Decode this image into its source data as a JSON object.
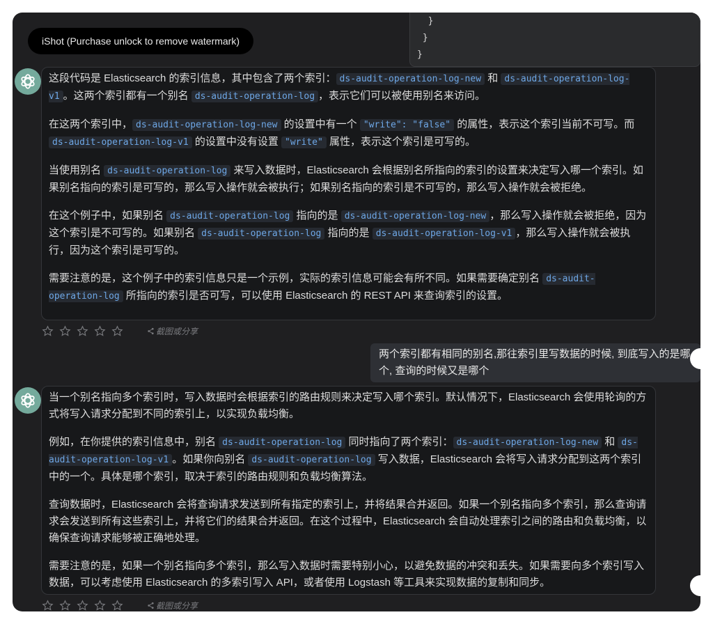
{
  "watermark": "iShot (Purchase unlock to remove watermark)",
  "code_tail": [
    "  }",
    " }",
    "}"
  ],
  "message1": {
    "p1": {
      "t1": "这段代码是 Elasticsearch 的索引信息，其中包含了两个索引：",
      "c1": "ds-audit-operation-log-new",
      "t2": " 和 ",
      "c2": "ds-audit-operation-log-v1",
      "t3": "。这两个索引都有一个别名 ",
      "c3": "ds-audit-operation-log",
      "t4": "，表示它们可以被使用别名来访问。"
    },
    "p2": {
      "t1": "在这两个索引中，",
      "c1": "ds-audit-operation-log-new",
      "t2": " 的设置中有一个 ",
      "c2": "\"write\": \"false\"",
      "t3": " 的属性，表示这个索引当前不可写。而 ",
      "c3": "ds-audit-operation-log-v1",
      "t4": " 的设置中没有设置 ",
      "c4": "\"write\"",
      "t5": " 属性，表示这个索引是可写的。"
    },
    "p3": {
      "t1": "当使用别名 ",
      "c1": "ds-audit-operation-log",
      "t2": " 来写入数据时，Elasticsearch 会根据别名所指向的索引的设置来决定写入哪一个索引。如果别名指向的索引是可写的，那么写入操作就会被执行；如果别名指向的索引是不可写的，那么写入操作就会被拒绝。"
    },
    "p4": {
      "t1": "在这个例子中，如果别名 ",
      "c1": "ds-audit-operation-log",
      "t2": " 指向的是 ",
      "c2": "ds-audit-operation-log-new",
      "t3": "，那么写入操作就会被拒绝，因为这个索引是不可写的。如果别名 ",
      "c3": "ds-audit-operation-log",
      "t4": " 指向的是 ",
      "c4": "ds-audit-operation-log-v1",
      "t5": "，那么写入操作就会被执行，因为这个索引是可写的。"
    },
    "p5": {
      "t1": "需要注意的是，这个例子中的索引信息只是一个示例，实际的索引信息可能会有所不同。如果需要确定别名 ",
      "c1": "ds-audit-operation-log",
      "t2": " 所指向的索引是否可写，可以使用 Elasticsearch 的 REST API 来查询索引的设置。"
    }
  },
  "share_label": "截图或分享",
  "user_message": "两个索引都有相同的别名,那往索引里写数据的时候, 到底写入的是哪个, 查询的时候又是哪个",
  "message2": {
    "p1": {
      "t1": "当一个别名指向多个索引时，写入数据时会根据索引的路由规则来决定写入哪个索引。默认情况下，Elasticsearch 会使用轮询的方式将写入请求分配到不同的索引上，以实现负载均衡。"
    },
    "p2": {
      "t1": "例如，在你提供的索引信息中，别名 ",
      "c1": "ds-audit-operation-log",
      "t2": " 同时指向了两个索引：",
      "c2": "ds-audit-operation-log-new",
      "t3": " 和 ",
      "c3": "ds-audit-operation-log-v1",
      "t4": "。如果你向别名 ",
      "c4": "ds-audit-operation-log",
      "t5": " 写入数据，Elasticsearch 会将写入请求分配到这两个索引中的一个。具体是哪个索引，取决于索引的路由规则和负载均衡算法。"
    },
    "p3": {
      "t1": "查询数据时，Elasticsearch 会将查询请求发送到所有指定的索引上，并将结果合并返回。如果一个别名指向多个索引，那么查询请求会发送到所有这些索引上，并将它们的结果合并返回。在这个过程中，Elasticsearch 会自动处理索引之间的路由和负载均衡，以确保查询请求能够被正确地处理。"
    },
    "p4": {
      "t1": "需要注意的是，如果一个别名指向多个索引，那么写入数据时需要特别小心，以避免数据的冲突和丢失。如果需要向多个索引写入数据，可以考虑使用 Elasticsearch 的多索引写入 API，或者使用 Logstash 等工具来实现数据的复制和同步。"
    }
  }
}
